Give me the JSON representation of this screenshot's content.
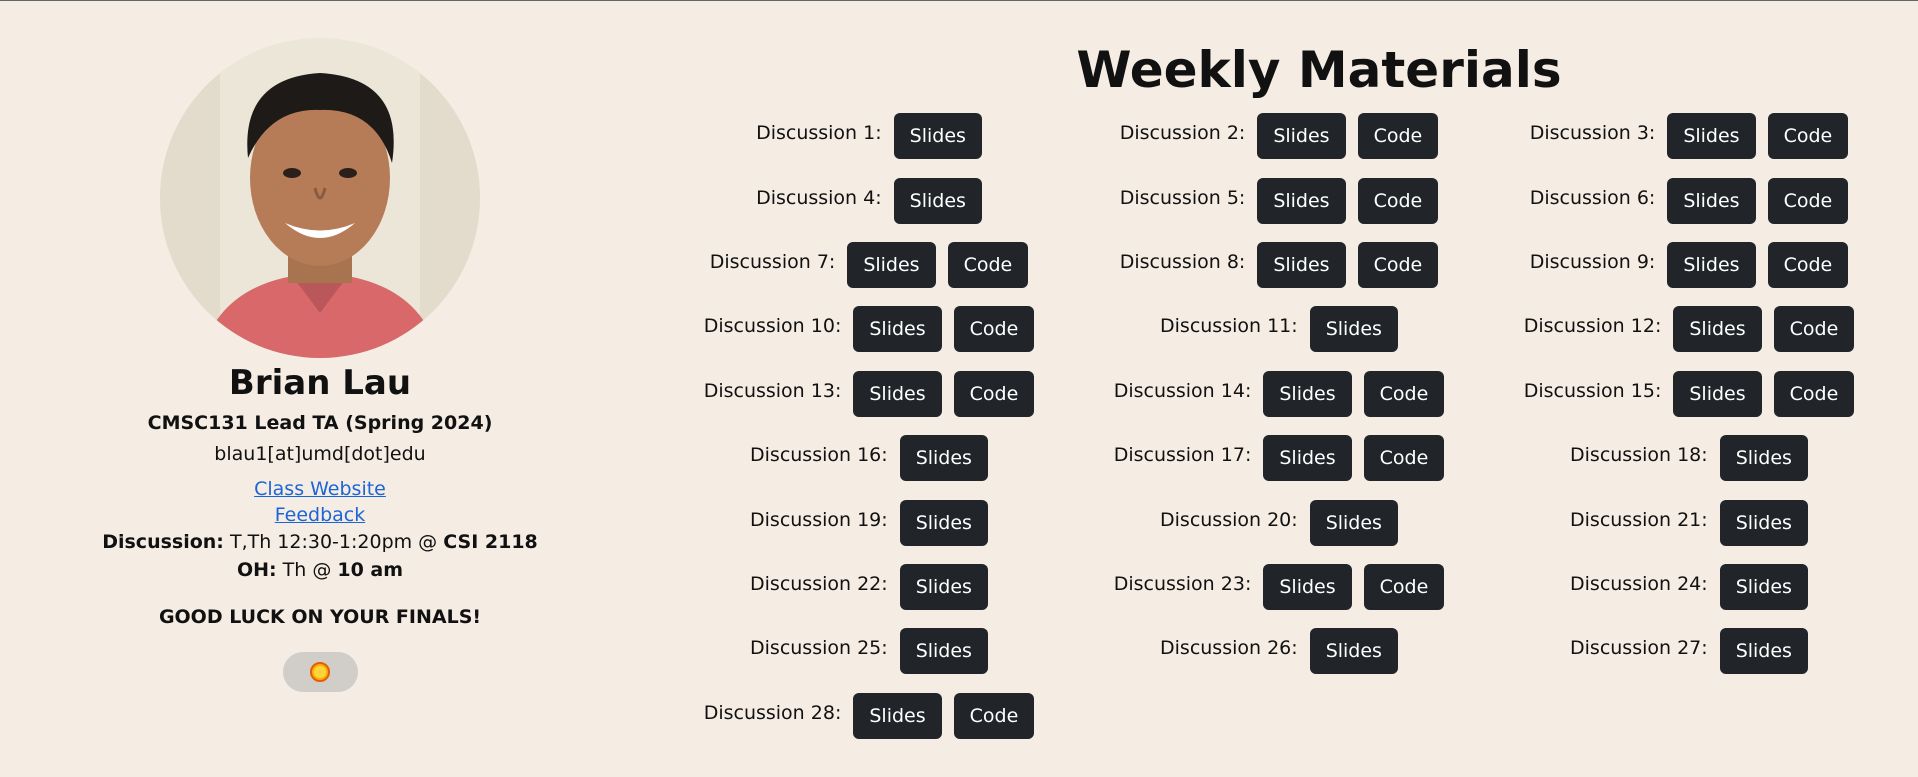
{
  "profile": {
    "name": "Brian Lau",
    "role": "CMSC131 Lead TA (Spring 2024)",
    "email": "blau1[at]umd[dot]edu",
    "links": [
      "Class Website",
      "Feedback"
    ],
    "discussion_label": "Discussion:",
    "discussion_time": " T,Th 12:30-1:20pm @ ",
    "discussion_room": "CSI 2118",
    "oh_label": "OH:",
    "oh_time": " Th @ ",
    "oh_hour": "10 am",
    "message": "GOOD LUCK ON YOUR FINALS!",
    "theme_toggle_icon": "sun-icon"
  },
  "materials": {
    "title": "Weekly Materials",
    "slides_label": "Slides",
    "code_label": "Code",
    "discussions": [
      {
        "label": "Discussion 1:",
        "has_code": false
      },
      {
        "label": "Discussion 2:",
        "has_code": true
      },
      {
        "label": "Discussion 3:",
        "has_code": true
      },
      {
        "label": "Discussion 4:",
        "has_code": false
      },
      {
        "label": "Discussion 5:",
        "has_code": true
      },
      {
        "label": "Discussion 6:",
        "has_code": true
      },
      {
        "label": "Discussion 7:",
        "has_code": true
      },
      {
        "label": "Discussion 8:",
        "has_code": true
      },
      {
        "label": "Discussion 9:",
        "has_code": true
      },
      {
        "label": "Discussion 10:",
        "has_code": true
      },
      {
        "label": "Discussion 11:",
        "has_code": false
      },
      {
        "label": "Discussion 12:",
        "has_code": true
      },
      {
        "label": "Discussion 13:",
        "has_code": true
      },
      {
        "label": "Discussion 14:",
        "has_code": true
      },
      {
        "label": "Discussion 15:",
        "has_code": true
      },
      {
        "label": "Discussion 16:",
        "has_code": false
      },
      {
        "label": "Discussion 17:",
        "has_code": true
      },
      {
        "label": "Discussion 18:",
        "has_code": false
      },
      {
        "label": "Discussion 19:",
        "has_code": false
      },
      {
        "label": "Discussion 20:",
        "has_code": false
      },
      {
        "label": "Discussion 21:",
        "has_code": false
      },
      {
        "label": "Discussion 22:",
        "has_code": false
      },
      {
        "label": "Discussion 23:",
        "has_code": true
      },
      {
        "label": "Discussion 24:",
        "has_code": false
      },
      {
        "label": "Discussion 25:",
        "has_code": false
      },
      {
        "label": "Discussion 26:",
        "has_code": false
      },
      {
        "label": "Discussion 27:",
        "has_code": false
      },
      {
        "label": "Discussion 28:",
        "has_code": true
      }
    ]
  },
  "colors": {
    "background": "#f5ece3",
    "button": "#212529",
    "link": "#1a66d6"
  }
}
